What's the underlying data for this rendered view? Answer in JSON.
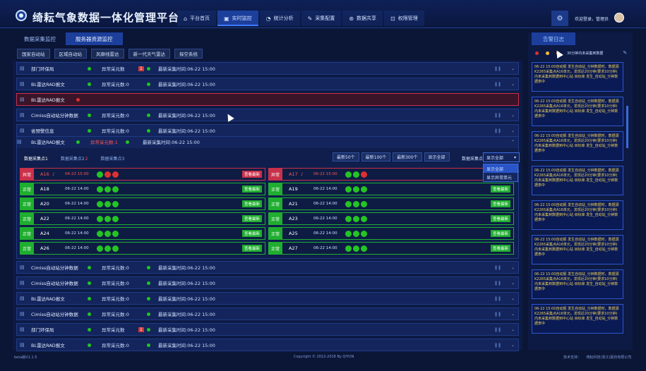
{
  "header": {
    "title": "绮耘气象数据一体化管理平台",
    "nav": [
      {
        "label": "平台首页",
        "icon": "home-icon",
        "glyph": "⌂"
      },
      {
        "label": "实时监控",
        "icon": "monitor-icon",
        "glyph": "▣"
      },
      {
        "label": "统计分析",
        "icon": "chart-icon",
        "glyph": "◔"
      },
      {
        "label": "采集配置",
        "icon": "pen-icon",
        "glyph": "✎"
      },
      {
        "label": "数据共享",
        "icon": "share-icon",
        "glyph": "⊛"
      },
      {
        "label": "权限管理",
        "icon": "lock-icon",
        "glyph": "⊡"
      }
    ],
    "welcome": "欢迎登录，管理员"
  },
  "tabs": [
    "数据采集监控",
    "服务器资源监控"
  ],
  "subtabs": [
    "国家自动站",
    "区域自动站",
    "风廓线雷达",
    "新一代天气雷达",
    "探空系统"
  ],
  "rows_top": [
    {
      "name": "部门环保局",
      "status": "异常采元数",
      "badge": "1",
      "time": "最新采集时间:06-22 15:00",
      "alarm": true
    },
    {
      "name": "BL雷达RAD报文",
      "status": "异常采元数:0",
      "time": "最新采集时间:06-22 15:00"
    },
    {
      "name": "BL雷达RAD报文",
      "status": "",
      "time": "",
      "selected": true
    },
    {
      "name": "Cimiss自动站分钟数据",
      "status": "异常采元数:0",
      "time": "最新采集时间:06-22 15:00"
    },
    {
      "name": "省预警信息",
      "status": "异常采元数:0",
      "time": "最新采集时间:06-22 15:00"
    }
  ],
  "expanded": {
    "name": "BL雷达RAD报文",
    "status": "异常采元数:1",
    "time": "最新采集时间:06-22 15:00",
    "tabs": [
      "数据采集点1",
      "数据采集点2",
      "数据采集点3"
    ],
    "tab_badge": "2",
    "buttons": [
      "最新50个",
      "最新100个",
      "最新300个",
      "显示全部"
    ],
    "mode_label": "数据采集点1",
    "select": "显示全部",
    "options": [
      "显示全部",
      "显示异常单元"
    ],
    "cards": [
      {
        "status": "异常",
        "name": "A16",
        "time": "06-22 15:00",
        "lights": "gr r",
        "btn": "查看最新",
        "alarm": true
      },
      {
        "status": "异常",
        "name": "A17",
        "time": "06-22 15:00",
        "lights": "g g r",
        "btn": "",
        "alarm": true
      },
      {
        "status": "正常",
        "name": "A18",
        "time": "06-22 14:00",
        "lights": "g g g",
        "btn": "查看最新"
      },
      {
        "status": "正常",
        "name": "A19",
        "time": "06-22 14:00",
        "lights": "g g g",
        "btn": "查看最新"
      },
      {
        "status": "正常",
        "name": "A20",
        "time": "06-22 14:00",
        "lights": "g g g",
        "btn": "查看最新"
      },
      {
        "status": "正常",
        "name": "A21",
        "time": "06-22 14:00",
        "lights": "g g g",
        "btn": "查看最新"
      },
      {
        "status": "正常",
        "name": "A22",
        "time": "06-22 14:00",
        "lights": "g g g",
        "btn": "查看最新"
      },
      {
        "status": "正常",
        "name": "A23",
        "time": "06-22 14:00",
        "lights": "g g g",
        "btn": "查看最新"
      },
      {
        "status": "正常",
        "name": "A24",
        "time": "06-22 14:00",
        "lights": "g g g",
        "btn": "查看最新"
      },
      {
        "status": "正常",
        "name": "A25",
        "time": "06-22 14:00",
        "lights": "g g g",
        "btn": "查看最新"
      },
      {
        "status": "正常",
        "name": "A26",
        "time": "06-22 14:00",
        "lights": "g g g",
        "btn": "查看最新"
      },
      {
        "status": "正常",
        "name": "A27",
        "time": "06-22 14:00",
        "lights": "g g g",
        "btn": "查看最新"
      }
    ]
  },
  "rows_bottom": [
    {
      "name": "Cimiss自动站分钟数据",
      "status": "异常采元数:0",
      "time": "最新采集时间:06-22 15:00"
    },
    {
      "name": "Cimiss自动站分钟数据",
      "status": "异常采元数:0",
      "time": "最新采集时间:06-22 15:00"
    },
    {
      "name": "BL雷达RAD报文",
      "status": "异常采元数:0",
      "time": "最新采集时间:06-22 15:00"
    },
    {
      "name": "Cimiss自动站分钟数据",
      "status": "异常采元数:0",
      "time": "最新采集时间:06-22 15:00"
    },
    {
      "name": "部门环保局",
      "status": "异常采元数",
      "badge": "1",
      "time": "最新采集时间:06-22 15:00",
      "alarm": true
    },
    {
      "name": "BL雷达RAD报文",
      "status": "异常采元数:0",
      "time": "最新采集时间:06-22 15:00"
    }
  ],
  "log": {
    "title": "告警日志",
    "tool_text": "30分钟内未采集到数据",
    "entry": "06-22 15:00自动报 发生自动站_分钟数据时，数据源K2265采集点A16单元，发现近20分钟(要求10分钟)内未采集到数据到中心站 目标库 发生_自动站_分钟数据表中"
  },
  "footer": {
    "version": "beta版V1.1.5",
    "copyright": "Copyright © 2012-2018 By QIYUN",
    "support": "技术支持：　　绮耘科技(浙江)股份有限公司"
  }
}
